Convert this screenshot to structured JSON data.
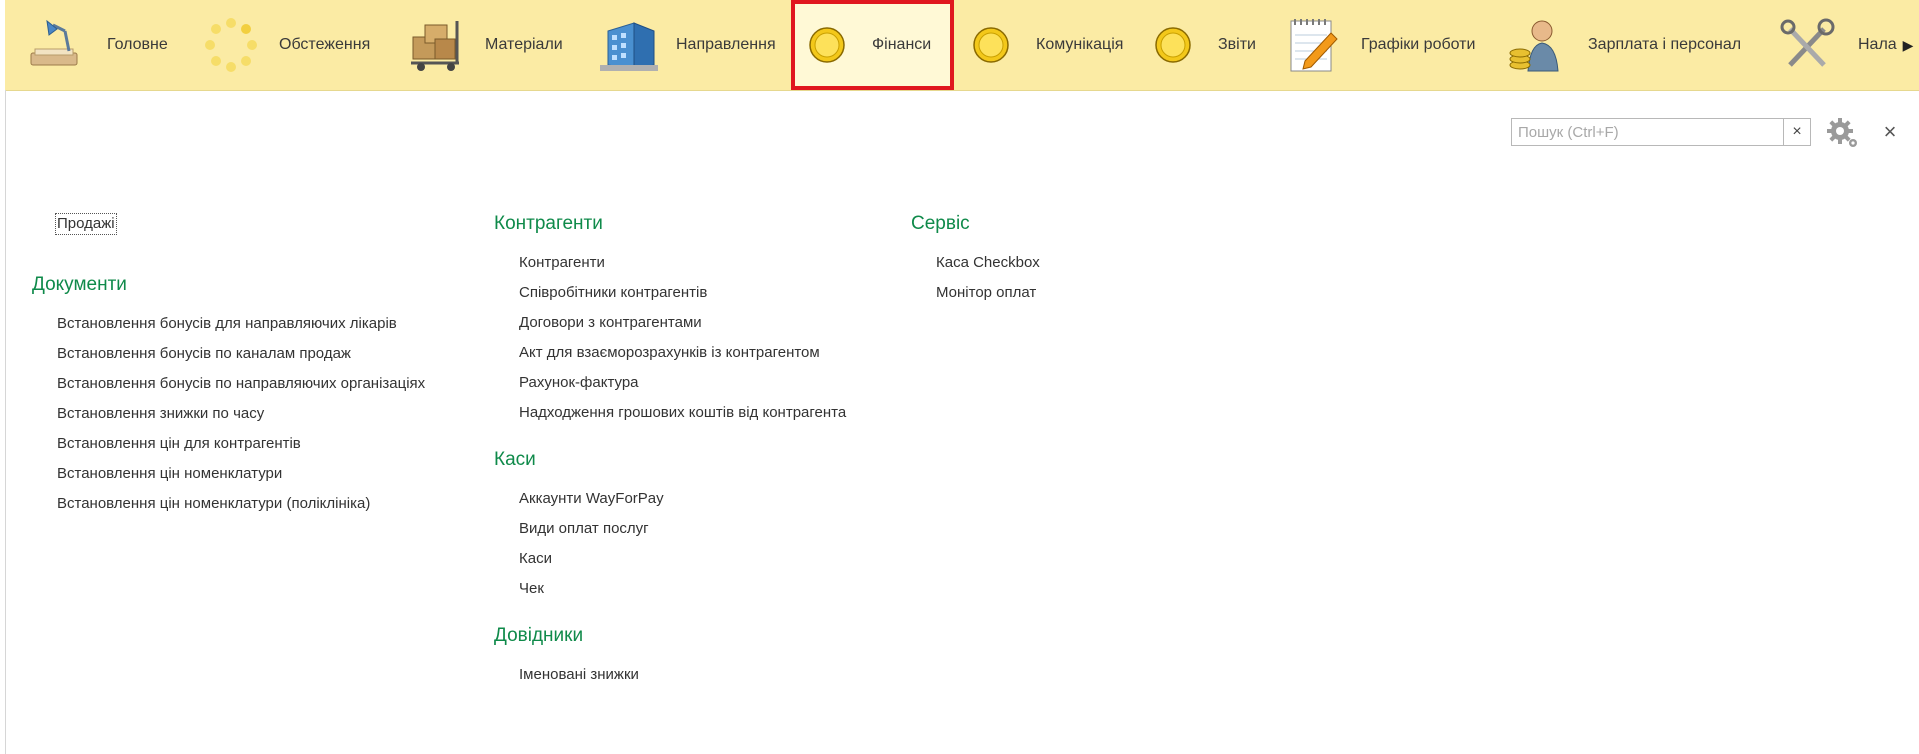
{
  "sections": [
    {
      "label": "Головне",
      "icon": "desk-lamp-icon"
    },
    {
      "label": "Обстеження",
      "icon": "loading-spinner-icon"
    },
    {
      "label": "Матеріали",
      "icon": "boxes-cart-icon"
    },
    {
      "label": "Направлення",
      "icon": "building-icon"
    },
    {
      "label": "Фінанси",
      "icon": "coin-icon"
    },
    {
      "label": "Комунікація",
      "icon": "coin-icon"
    },
    {
      "label": "Звіти",
      "icon": "coin-icon"
    },
    {
      "label": "Графіки роботи",
      "icon": "notepad-pencil-icon"
    },
    {
      "label": "Зарплата і персонал",
      "icon": "worker-coins-icon"
    },
    {
      "label": "Налаш",
      "icon": "tools-icon"
    }
  ],
  "active_section": "Фінанси",
  "search": {
    "placeholder": "Пошук (Ctrl+F)",
    "value": ""
  },
  "colors": {
    "panel": "#fbeba4",
    "active_outline": "#e0171f",
    "group_title": "#0f8a4a"
  },
  "col1": {
    "top_link": "Продажі",
    "groups": [
      {
        "title": "Документи",
        "items": [
          "Встановлення бонусів для направляючих лікарів",
          "Встановлення бонусів по каналам продаж",
          "Встановлення бонусів по направляючих організаціях",
          "Встановлення знижки по часу",
          "Встановлення цін для контрагентів",
          "Встановлення цін номенклатури",
          "Встановлення цін номенклатури (поліклініка)"
        ]
      }
    ]
  },
  "col2": {
    "groups": [
      {
        "title": "Контрагенти",
        "items": [
          "Контрагенти",
          "Співробітники контрагентів",
          "Договори з контрагентами",
          "Акт для взаєморозрахунків із контрагентом",
          "Рахунок-фактура",
          "Надходження грошових коштів від контрагента"
        ]
      },
      {
        "title": "Каси",
        "items": [
          "Аккаунти WayForPay",
          "Види оплат послуг",
          "Каси",
          "Чек"
        ]
      },
      {
        "title": "Довідники",
        "items": [
          "Іменовані знижки"
        ]
      }
    ]
  },
  "col3": {
    "groups": [
      {
        "title": "Сервіс",
        "items": [
          "Каса Checkbox",
          "Монітор оплат"
        ]
      }
    ]
  }
}
